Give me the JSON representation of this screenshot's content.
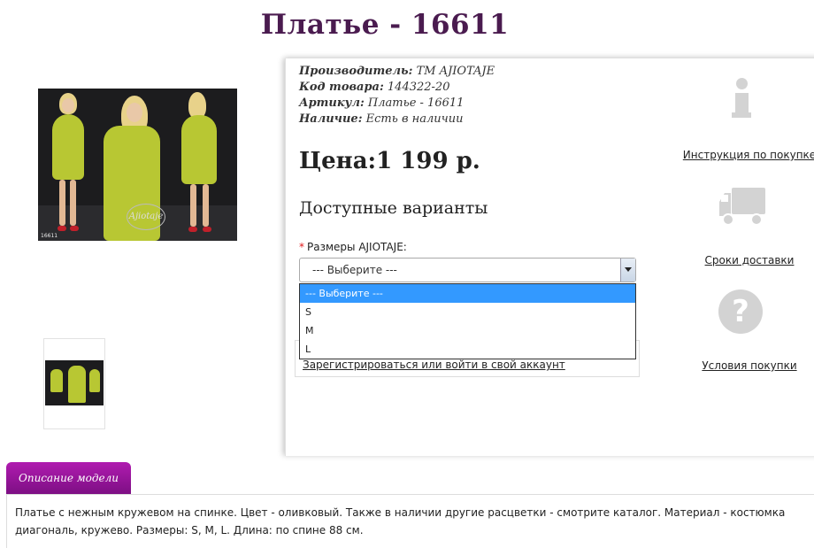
{
  "product": {
    "title": "Платье - 16611",
    "photo_code": "16611",
    "photo_logo": "Ajiotaje"
  },
  "props": [
    {
      "label": "Производитель:",
      "value": "TM AJIOTAJE"
    },
    {
      "label": "Код товара:",
      "value": "144322-20"
    },
    {
      "label": "Артикул:",
      "value": "Платье - 16611"
    },
    {
      "label": "Наличие:",
      "value": "Есть в наличии"
    }
  ],
  "price": "Цена:1 199 р.",
  "variants": {
    "title": "Доступные варианты",
    "size_required_mark": "*",
    "size_label": "Размеры AJIOTAJE:",
    "selected": "--- Выберите ---",
    "options": [
      "--- Выберите ---",
      "S",
      "M",
      "L"
    ]
  },
  "register_link": "Зарегистрироваться или войти в свой аккаунт",
  "sidebar": {
    "instruction_link": "Инструкция по покупке",
    "delivery_link": "Сроки доставки",
    "terms_link": "Условия покупки",
    "info_icon": "info-icon",
    "truck_icon": "truck-icon",
    "question_icon": "question-icon",
    "question_glyph": "?"
  },
  "description": {
    "tab_label": "Описание модели",
    "text": "Платье с нежным кружевом на спинке. Цвет - оливковый. Также в наличии другие расцветки - смотрите каталог. Материал - костюмка диагональ, кружево. Размеры: S, M, L. Длина: по спине 88 см."
  },
  "colors": {
    "title": "#4a1b4f",
    "tab": "#9b1a9f",
    "dress": "#b8c733",
    "dropdown_highlight": "#3399ff"
  }
}
